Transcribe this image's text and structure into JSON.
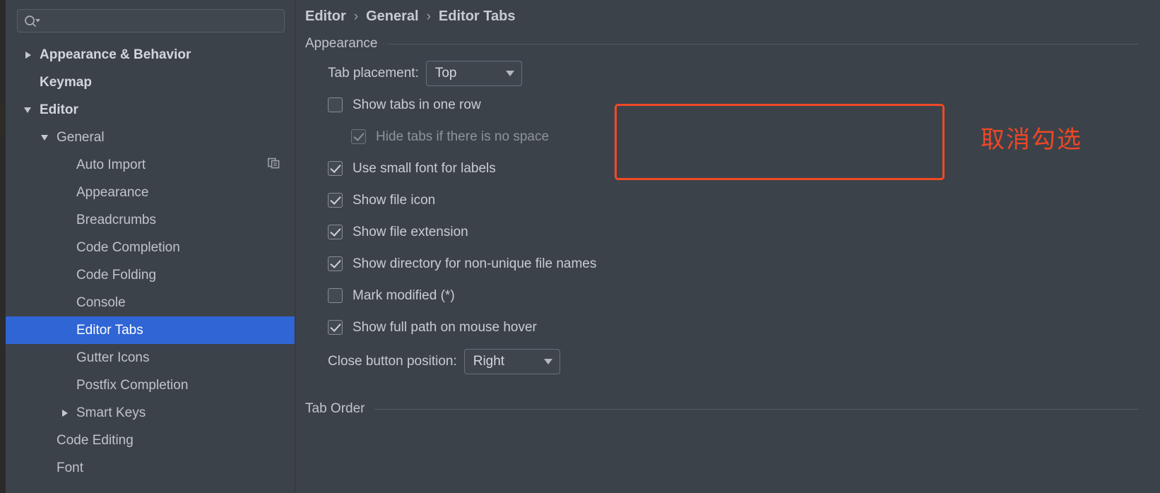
{
  "app": {
    "theme_accent": "#2f65d4",
    "annotation_color": "#f04a25",
    "background": "#3c424a"
  },
  "sidebar": {
    "search": {
      "placeholder": "",
      "value": "",
      "icon": "search-icon"
    },
    "items": [
      {
        "label": "Appearance & Behavior",
        "level": 0,
        "arrow": "right",
        "bold": true,
        "selected": false,
        "trailing_icon": ""
      },
      {
        "label": "Keymap",
        "level": 0,
        "arrow": "none",
        "bold": true,
        "selected": false,
        "trailing_icon": ""
      },
      {
        "label": "Editor",
        "level": 0,
        "arrow": "down",
        "bold": true,
        "selected": false,
        "trailing_icon": ""
      },
      {
        "label": "General",
        "level": 1,
        "arrow": "down",
        "bold": false,
        "selected": false,
        "trailing_icon": ""
      },
      {
        "label": "Auto Import",
        "level": 2,
        "arrow": "none",
        "bold": false,
        "selected": false,
        "trailing_icon": "copy-icon"
      },
      {
        "label": "Appearance",
        "level": 2,
        "arrow": "none",
        "bold": false,
        "selected": false,
        "trailing_icon": ""
      },
      {
        "label": "Breadcrumbs",
        "level": 2,
        "arrow": "none",
        "bold": false,
        "selected": false,
        "trailing_icon": ""
      },
      {
        "label": "Code Completion",
        "level": 2,
        "arrow": "none",
        "bold": false,
        "selected": false,
        "trailing_icon": ""
      },
      {
        "label": "Code Folding",
        "level": 2,
        "arrow": "none",
        "bold": false,
        "selected": false,
        "trailing_icon": ""
      },
      {
        "label": "Console",
        "level": 2,
        "arrow": "none",
        "bold": false,
        "selected": false,
        "trailing_icon": ""
      },
      {
        "label": "Editor Tabs",
        "level": 2,
        "arrow": "none",
        "bold": false,
        "selected": true,
        "trailing_icon": ""
      },
      {
        "label": "Gutter Icons",
        "level": 2,
        "arrow": "none",
        "bold": false,
        "selected": false,
        "trailing_icon": ""
      },
      {
        "label": "Postfix Completion",
        "level": 2,
        "arrow": "none",
        "bold": false,
        "selected": false,
        "trailing_icon": ""
      },
      {
        "label": "Smart Keys",
        "level": 2,
        "arrow": "right",
        "bold": false,
        "selected": false,
        "trailing_icon": ""
      },
      {
        "label": "Code Editing",
        "level": 1,
        "arrow": "none",
        "bold": false,
        "selected": false,
        "trailing_icon": ""
      },
      {
        "label": "Font",
        "level": 1,
        "arrow": "none",
        "bold": false,
        "selected": false,
        "trailing_icon": ""
      }
    ]
  },
  "main": {
    "breadcrumb": {
      "part1": "Editor",
      "sep1": "›",
      "part2": "General",
      "sep2": "›",
      "part3": "Editor Tabs"
    },
    "appearance_section": {
      "title": "Appearance"
    },
    "tab_placement": {
      "label": "Tab placement:",
      "value": "Top"
    },
    "checkboxes": [
      {
        "label": "Show tabs in one row",
        "checked": false,
        "indent": false,
        "disabled": false
      },
      {
        "label": "Hide tabs if there is no space",
        "checked": true,
        "indent": true,
        "disabled": true
      },
      {
        "label": "Use small font for labels",
        "checked": true,
        "indent": false,
        "disabled": false
      },
      {
        "label": "Show file icon",
        "checked": true,
        "indent": false,
        "disabled": false
      },
      {
        "label": "Show file extension",
        "checked": true,
        "indent": false,
        "disabled": false
      },
      {
        "label": "Show directory for non-unique file names",
        "checked": true,
        "indent": false,
        "disabled": false
      },
      {
        "label": "Mark modified (*)",
        "checked": false,
        "indent": false,
        "disabled": false
      },
      {
        "label": "Show full path on mouse hover",
        "checked": true,
        "indent": false,
        "disabled": false
      }
    ],
    "close_button_position": {
      "label": "Close button position:",
      "value": "Right"
    },
    "tab_order_section": {
      "title": "Tab Order"
    }
  },
  "annotation": {
    "text": "取消勾选"
  }
}
